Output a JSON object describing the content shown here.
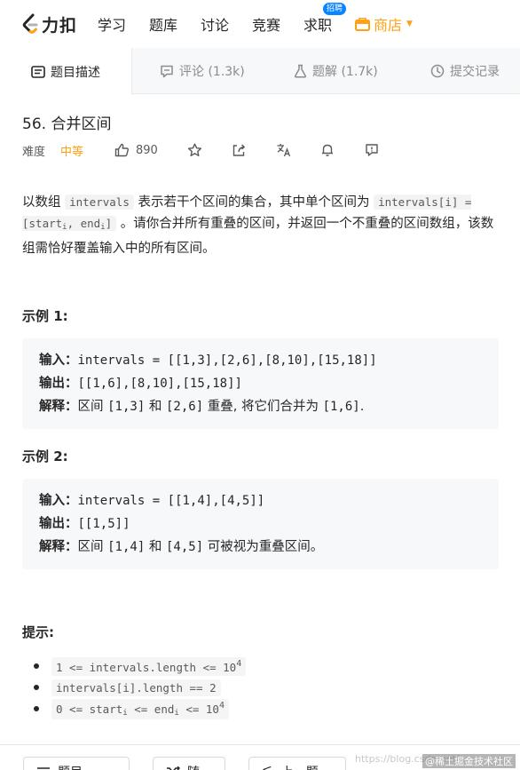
{
  "nav": {
    "logo_text": "力扣",
    "items": [
      {
        "label": "学习"
      },
      {
        "label": "题库"
      },
      {
        "label": "讨论"
      },
      {
        "label": "竞赛"
      },
      {
        "label": "求职",
        "badge": "招聘"
      }
    ],
    "shop_label": "商店",
    "accent_color": "#ffa116"
  },
  "tabs": [
    {
      "label": "题目描述",
      "icon": "description-icon",
      "active": true
    },
    {
      "label": "评论 (1.3k)",
      "icon": "comment-icon",
      "active": false
    },
    {
      "label": "题解 (1.7k)",
      "icon": "flask-icon",
      "active": false
    },
    {
      "label": "提交记录",
      "icon": "clock-icon",
      "active": false
    }
  ],
  "problem": {
    "title": "56. 合并区间",
    "difficulty_label": "难度",
    "difficulty": "中等",
    "likes": "890",
    "description": {
      "p1": "以数组",
      "code1": "intervals",
      "p2": "表示若干个区间的集合，其中单个区间为",
      "code2a": "intervals[i] = [start",
      "code2_sub1": "i",
      "code2b": ", end",
      "code2_sub2": "i",
      "code2c": "]",
      "p3": "。请你合并所有重叠的区间，并返回一个不重叠的区间数组，该数组需恰好覆盖输入中的所有区间。"
    }
  },
  "examples": [
    {
      "title": "示例 1:",
      "input_label": "输入：",
      "input": "intervals = [[1,3],[2,6],[8,10],[15,18]]",
      "output_label": "输出：",
      "output": "[[1,6],[8,10],[15,18]]",
      "explain_label": "解释：",
      "explain_parts": [
        "区间 ",
        "[1,3]",
        " 和 ",
        "[2,6]",
        " 重叠, 将它们合并为 ",
        "[1,6]",
        "."
      ]
    },
    {
      "title": "示例 2:",
      "input_label": "输入：",
      "input": "intervals = [[1,4],[4,5]]",
      "output_label": "输出：",
      "output": "[[1,5]]",
      "explain_label": "解释：",
      "explain_parts": [
        "区间 ",
        "[1,4]",
        " 和 ",
        "[4,5]",
        " 可被视为重叠区间。"
      ]
    }
  ],
  "hints": {
    "title": "提示:",
    "items": [
      {
        "pre": "1 <= intervals.length <= 10",
        "sup": "4"
      },
      {
        "pre": "intervals[i].length == 2"
      },
      {
        "pre": "0 <= start",
        "sub1": "i",
        "mid": " <= end",
        "sub2": "i",
        "post": " <= 10",
        "sup": "4"
      }
    ]
  },
  "bottom": {
    "buttons": [
      "题目",
      "随",
      "上一题"
    ],
    "watermark": "https://blog.csdn.net/...",
    "watermark2": "@稀土掘金技术社区"
  }
}
